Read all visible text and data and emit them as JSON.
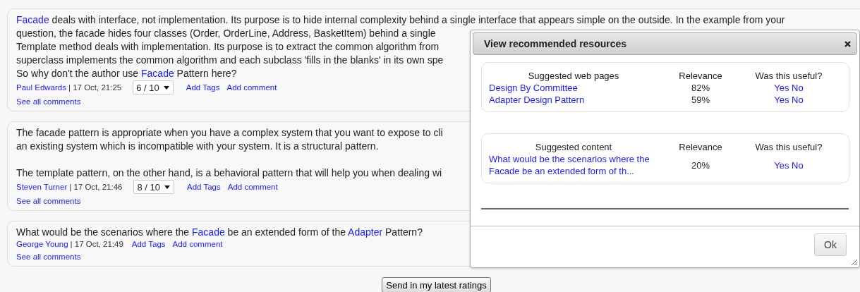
{
  "posts": [
    {
      "paragraphs": [
        [
          [
            {
              "text": "Facade",
              "kind": "link"
            },
            {
              "text": " deals with interface, not implementation. Its purpose is to hide internal complexity behind a single interface that appears simple on the outside. In the example from your",
              "kind": "text"
            }
          ],
          [
            {
              "text": "question, the facade hides four classes (Order, OrderLine, Address, BasketItem) behind a single",
              "kind": "text"
            }
          ],
          [
            {
              "text": "Template method deals with implementation. Its purpose is to extract the common algorithm from",
              "kind": "text"
            }
          ],
          [
            {
              "text": "superclass implements the common algorithm and each subclass 'fills in the blanks' in its own spe",
              "kind": "text"
            }
          ],
          [
            {
              "text": "So why don't the author use ",
              "kind": "text"
            },
            {
              "text": "Facade",
              "kind": "link"
            },
            {
              "text": " Pattern here?",
              "kind": "text"
            }
          ]
        ]
      ],
      "author": "Paul Edwards",
      "date": "| 17 Oct, 21:25",
      "rating": "6 / 10",
      "add_tags": "Add Tags",
      "add_comment": "Add comment",
      "see_all": "See all comments"
    },
    {
      "paragraphs": [
        [
          [
            {
              "text": "The facade pattern is appropriate when you have a complex system that you want to expose to cli",
              "kind": "text"
            }
          ],
          [
            {
              "text": "an existing system which is incompatible with your system. It is a structural pattern.",
              "kind": "text"
            }
          ]
        ],
        [
          [
            {
              "text": "The template pattern, on the other hand, is a behavioral pattern that will help you when dealing wi",
              "kind": "text"
            }
          ]
        ]
      ],
      "author": "Steven Turner",
      "date": "| 17 Oct, 21:46",
      "rating": "8 / 10",
      "add_tags": "Add Tags",
      "add_comment": "Add comment",
      "see_all": "See all comments"
    },
    {
      "paragraphs": [
        [
          [
            {
              "text": "What would be the scenarios where the ",
              "kind": "text"
            },
            {
              "text": "Facade",
              "kind": "link"
            },
            {
              "text": " be an extended form of the ",
              "kind": "text"
            },
            {
              "text": "Adapter",
              "kind": "link"
            },
            {
              "text": " Pattern?",
              "kind": "text"
            }
          ]
        ]
      ],
      "author": "George Young",
      "date": "| 17 Oct, 21:49",
      "add_tags": "Add Tags",
      "add_comment": "Add comment",
      "see_all": "See all comments"
    }
  ],
  "send_button": "Send in my latest ratings",
  "dialog": {
    "title": "View recommended resources",
    "sections": [
      {
        "columns": [
          "Suggested web pages",
          "Relevance",
          "Was this useful?"
        ],
        "rows": [
          {
            "title": "Design By Committee",
            "relevance": "82%",
            "yes": "Yes",
            "no": "No"
          },
          {
            "title": "Adapter Design Pattern",
            "relevance": "59%",
            "yes": "Yes",
            "no": "No"
          }
        ]
      },
      {
        "columns": [
          "Suggested content",
          "Relevance",
          "Was this useful?"
        ],
        "rows": [
          {
            "title": "What would be the scenarios where the Facade be an extended form of th...",
            "relevance": "20%",
            "yes": "Yes",
            "no": "No"
          }
        ]
      }
    ],
    "ok_button": "Ok"
  }
}
